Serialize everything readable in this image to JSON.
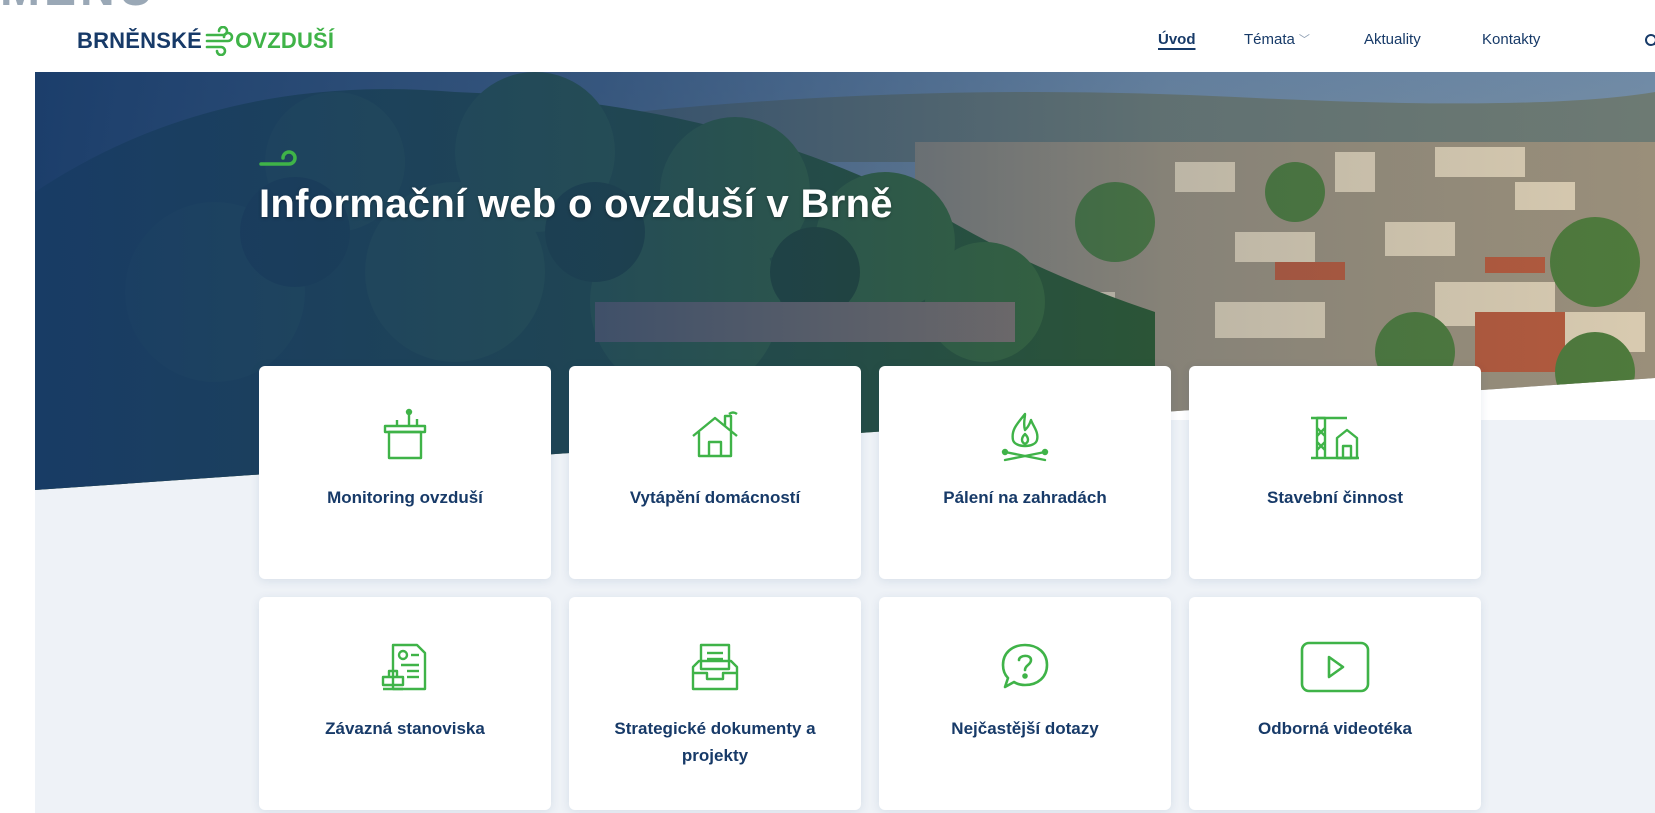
{
  "header": {
    "corner_fragment": "MENU",
    "logo": {
      "part1": "BRNĚNSKÉ",
      "part2": "OVZDUŠÍ"
    },
    "nav": [
      {
        "label": "Úvod",
        "active": true
      },
      {
        "label": "Témata",
        "dropdown": true
      },
      {
        "label": "Aktuality"
      },
      {
        "label": "Kontakty"
      }
    ],
    "search_icon": "search-icon"
  },
  "hero": {
    "title": "Informační web o ovzduší v Brně",
    "background": "city-panorama-photo"
  },
  "cards": [
    {
      "label": "Monitoring ovzduší",
      "icon": "monitoring-station-icon"
    },
    {
      "label": "Vytápění domácností",
      "icon": "house-chimney-icon"
    },
    {
      "label": "Pálení na zahradách",
      "icon": "campfire-icon"
    },
    {
      "label": "Stavební činnost",
      "icon": "construction-crane-icon"
    },
    {
      "label": "Závazná stanoviska",
      "icon": "document-stamp-icon"
    },
    {
      "label": "Strategické dokumenty a projekty",
      "icon": "document-tray-icon"
    },
    {
      "label": "Nejčastější dotazy",
      "icon": "question-bubble-icon"
    },
    {
      "label": "Odborná videotéka",
      "icon": "video-play-icon"
    }
  ],
  "colors": {
    "navy": "#173a68",
    "green": "#3fb348",
    "band": "#eef2f7"
  }
}
